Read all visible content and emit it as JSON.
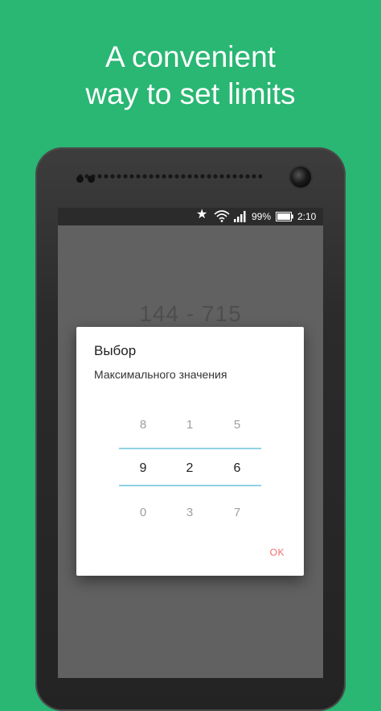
{
  "headline": {
    "line1": "A convenient",
    "line2": "way to set limits"
  },
  "statusbar": {
    "battery_percent": "99%",
    "time": "2:10",
    "icons": [
      "star-icon",
      "wifi-icon",
      "signal-icon",
      "battery-icon"
    ]
  },
  "background_screen": {
    "range_text": "144  -  715"
  },
  "dialog": {
    "title": "Выбор",
    "subtitle": "Максимального значения",
    "ok_label": "OK",
    "pickers": [
      {
        "above": "8",
        "selected": "9",
        "below": "0"
      },
      {
        "above": "1",
        "selected": "2",
        "below": "3"
      },
      {
        "above": "5",
        "selected": "6",
        "below": "7"
      }
    ]
  },
  "colors": {
    "background": "#2ab673",
    "accent_divider": "#8fd3e6",
    "ok_button": "#f06c6c"
  }
}
